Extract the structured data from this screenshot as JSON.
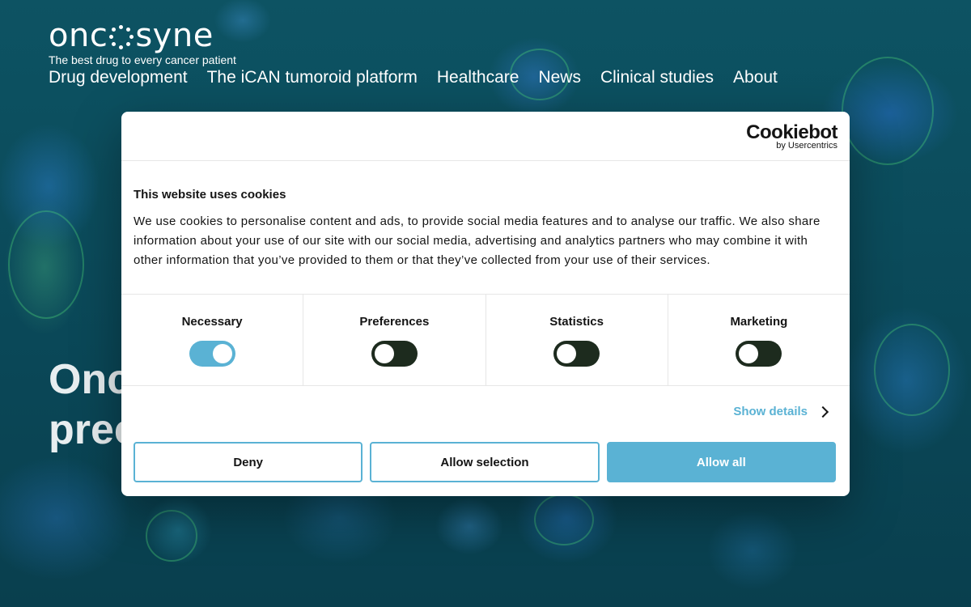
{
  "site": {
    "logo_text_left": "onc",
    "logo_text_right": "syne",
    "tagline": "The best drug to every cancer patient",
    "nav": [
      {
        "label": "Drug development"
      },
      {
        "label": "The iCAN tumoroid platform"
      },
      {
        "label": "Healthcare"
      },
      {
        "label": "News"
      },
      {
        "label": "Clinical studies"
      },
      {
        "label": "About"
      }
    ],
    "hero_line1": "Onc",
    "hero_line2": "prec"
  },
  "cookie_dialog": {
    "brand_word": "Cookiebot",
    "brand_sub": "by Usercentrics",
    "title": "This website uses cookies",
    "text": "We use cookies to personalise content and ads, to provide social media features and to analyse our traffic. We also share information about your use of our site with our social media, advertising and analytics partners who may combine it with other information that you’ve provided to them or that they’ve collected from your use of their services.",
    "categories": [
      {
        "label": "Necessary",
        "enabled": true
      },
      {
        "label": "Preferences",
        "enabled": false
      },
      {
        "label": "Statistics",
        "enabled": false
      },
      {
        "label": "Marketing",
        "enabled": false
      }
    ],
    "show_details": "Show details",
    "buttons": {
      "deny": "Deny",
      "allow_selection": "Allow selection",
      "allow_all": "Allow all"
    }
  },
  "colors": {
    "accent": "#5ab2d4",
    "toggle_off": "#1d2b1e",
    "background": "#0b4a5a"
  }
}
